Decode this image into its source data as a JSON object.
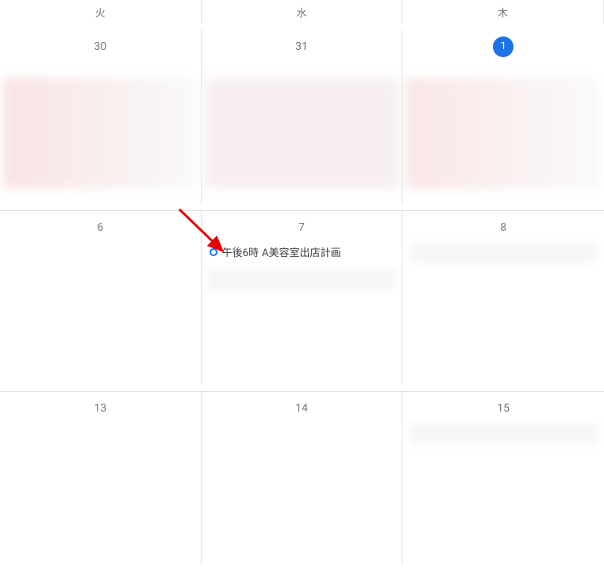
{
  "header": {
    "days": [
      "火",
      "水",
      "木"
    ]
  },
  "rows": [
    {
      "dates": [
        {
          "label": "30",
          "prevMonth": true
        },
        {
          "label": "31",
          "prevMonth": true
        },
        {
          "label": "1",
          "today": true
        }
      ]
    },
    {
      "dates": [
        {
          "label": "6"
        },
        {
          "label": "7"
        },
        {
          "label": "8"
        }
      ]
    },
    {
      "dates": [
        {
          "label": "13"
        },
        {
          "label": "14"
        },
        {
          "label": "15"
        }
      ]
    }
  ],
  "event": {
    "time": "午後6時",
    "title": "A美容室出店計画"
  },
  "colors": {
    "accent": "#1a73e8"
  }
}
